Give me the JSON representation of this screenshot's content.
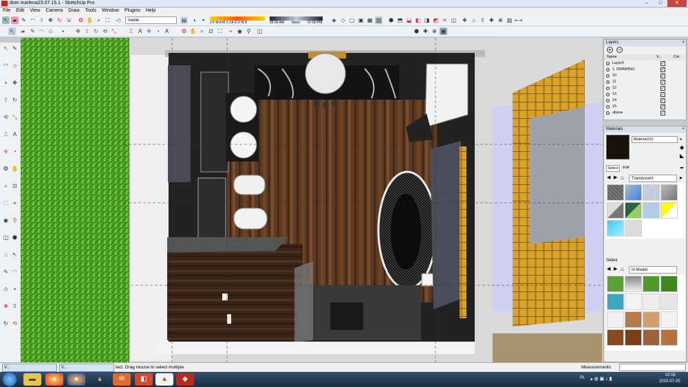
{
  "window": {
    "title": "dom marlena23.07.15.1 - SketchUp Pro"
  },
  "menu": [
    "File",
    "Edit",
    "View",
    "Camera",
    "Draw",
    "Tools",
    "Window",
    "Plugins",
    "Help"
  ],
  "toolbar": {
    "layer_combo": "meble",
    "months": "J F M A M J J A S O N D",
    "time_start": "05:00 AM",
    "time_noon": "Noon",
    "time_end": "07:00 PM"
  },
  "layers_panel": {
    "title": "Layers",
    "col_name": "Name",
    "col_visible": "V...",
    "col_color": "Col",
    "rows": [
      "Layer0",
      "1. DRAWING",
      "10",
      "11",
      "12",
      "13",
      "14",
      "15",
      "altana"
    ]
  },
  "materials_panel": {
    "title": "Materials",
    "current_material": "Material101",
    "tab_select": "Select",
    "tab_edit": "Edit",
    "library": "Translucent",
    "select_label": "Select",
    "model_combo": "In Model"
  },
  "status": {
    "hint": "lect. Drag mouse to select multiple.",
    "measurements_label": "Measurements"
  },
  "minimized": [
    {
      "label": "V..."
    },
    {
      "label": "V..."
    }
  ],
  "taskbar": {
    "lang": "PL",
    "time": "02:55",
    "date": "2015-07-25"
  },
  "colors": {
    "accent": "#d6dfeb",
    "floor": "#5a3a22"
  }
}
